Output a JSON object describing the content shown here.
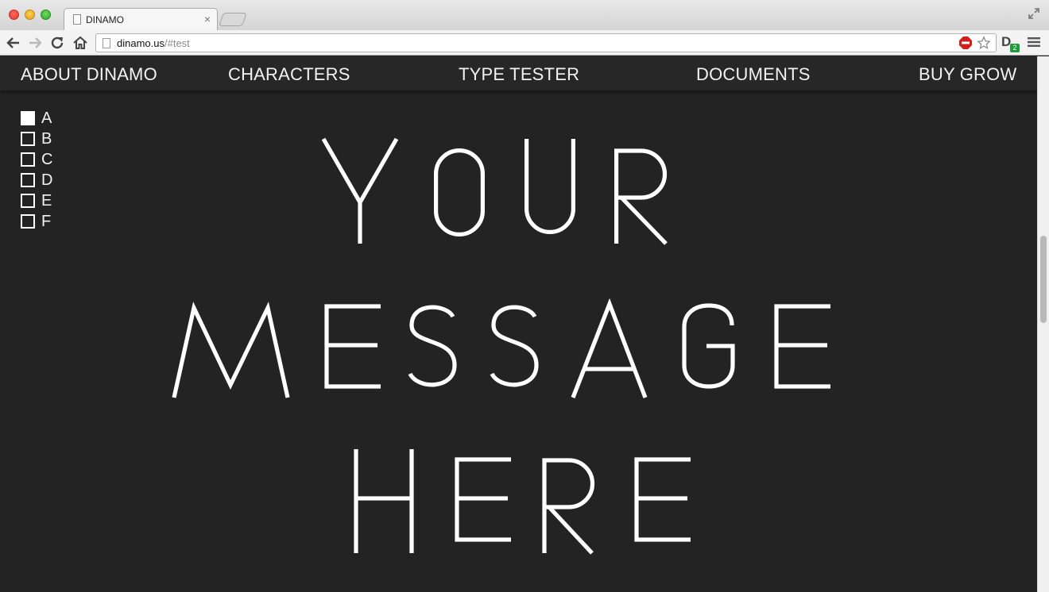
{
  "browser": {
    "tab_title": "DINAMO",
    "tab_close": "×",
    "url_host": "dinamo.us",
    "url_path": "/#test",
    "extension_letter": "D",
    "extension_badge": "2"
  },
  "nav": {
    "items": [
      "ABOUT DINAMO",
      "CHARACTERS",
      "TYPE TESTER",
      "DOCUMENTS",
      "BUY GROW"
    ]
  },
  "options": [
    {
      "label": "A",
      "checked": true
    },
    {
      "label": "B",
      "checked": false
    },
    {
      "label": "C",
      "checked": false
    },
    {
      "label": "D",
      "checked": false
    },
    {
      "label": "E",
      "checked": false
    },
    {
      "label": "F",
      "checked": false
    }
  ],
  "tester": {
    "lines": [
      "YOUR",
      "MESSAGE",
      "HERE"
    ]
  },
  "colors": {
    "background": "#232323",
    "text": "#ffffff"
  }
}
